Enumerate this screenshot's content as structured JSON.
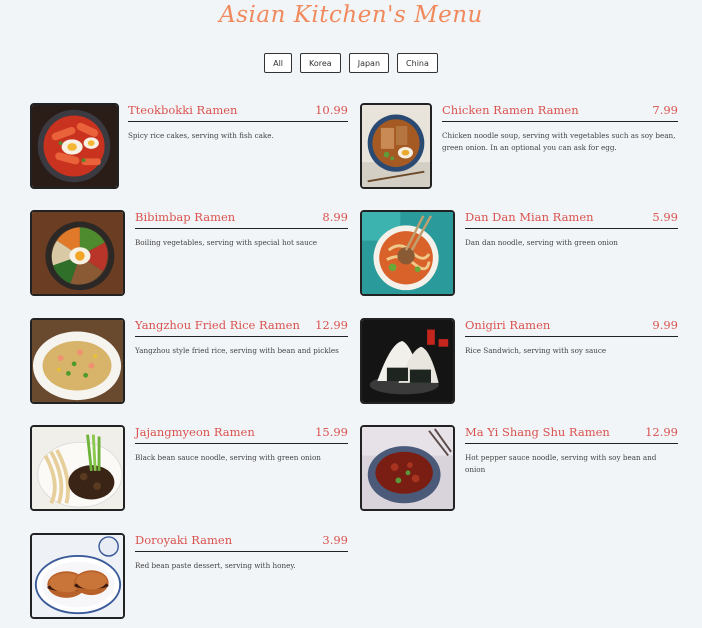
{
  "header": {
    "title": "Asian Kitchen's Menu"
  },
  "filters": [
    {
      "label": "All"
    },
    {
      "label": "Korea"
    },
    {
      "label": "Japan"
    },
    {
      "label": "China"
    }
  ],
  "menu": [
    {
      "name": "Tteokbokki Ramen",
      "price": "10.99",
      "desc": "Spicy rice cakes, serving with fish cake.",
      "image": "tteokbokki-photo"
    },
    {
      "name": "Chicken Ramen Ramen",
      "price": "7.99",
      "desc": "Chicken noodle soup, serving with vegetables such as soy bean, green onion. In an optional you can ask for egg.",
      "image": "chicken-ramen-photo"
    },
    {
      "name": "Bibimbap Ramen",
      "price": "8.99",
      "desc": "Boiling vegetables, serving with special hot sauce",
      "image": "bibimbap-photo"
    },
    {
      "name": "Dan Dan Mian Ramen",
      "price": "5.99",
      "desc": "Dan dan noodle, serving with green onion",
      "image": "dan-dan-mian-photo"
    },
    {
      "name": "Yangzhou Fried Rice Ramen",
      "price": "12.99",
      "desc": "Yangzhou style fried rice, serving with bean and pickles",
      "image": "fried-rice-photo"
    },
    {
      "name": "Onigiri Ramen",
      "price": "9.99",
      "desc": "Rice Sandwich, serving with soy sauce",
      "image": "onigiri-photo"
    },
    {
      "name": "Jajangmyeon Ramen",
      "price": "15.99",
      "desc": "Black bean sauce noodle, serving with green onion",
      "image": "jajangmyeon-photo"
    },
    {
      "name": "Ma Yi Shang Shu Ramen",
      "price": "12.99",
      "desc": "Hot pepper sauce noodle, serving with soy bean and onion",
      "image": "ma-yi-shang-shu-photo"
    },
    {
      "name": "Doroyaki Ramen",
      "price": "3.99",
      "desc": "Red bean paste dessert, serving with honey.",
      "image": "dorayaki-photo"
    }
  ]
}
